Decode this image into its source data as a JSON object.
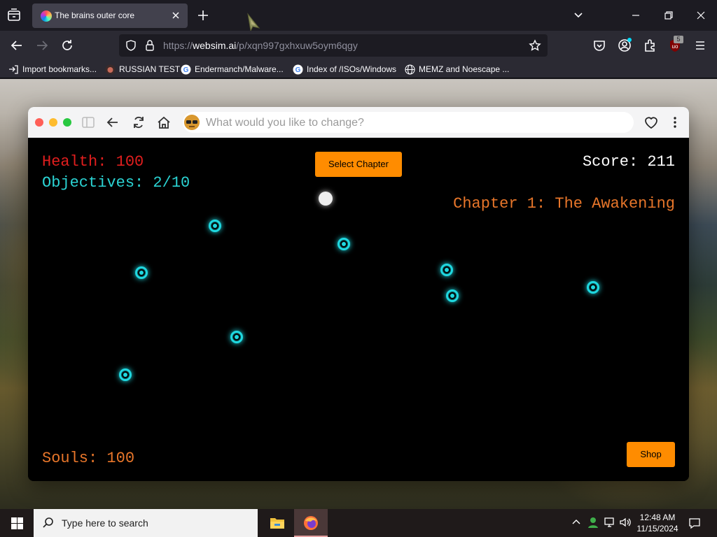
{
  "browser": {
    "tab_title": "The brains outer core",
    "url_prefix": "https://",
    "url_domain": "websim.ai",
    "url_path": "/p/xqn997gxhxuw5oym6qgy",
    "extension_badge": "5",
    "bookmarks": [
      {
        "label": "Import bookmarks...",
        "icon": "import-icon"
      },
      {
        "label": "RUSSIAN TEST",
        "icon": "octocat-icon"
      },
      {
        "label": "Endermanch/Malware...",
        "icon": "google-icon"
      },
      {
        "label": "Index of /ISOs/Windows",
        "icon": "google-icon"
      },
      {
        "label": "MEMZ and Noescape ...",
        "icon": "globe-icon"
      }
    ]
  },
  "websim": {
    "prompt_placeholder": "What would you like to change?"
  },
  "game": {
    "health": "Health: 100",
    "objectives": "Objectives: 2/10",
    "score": "Score: 211",
    "chapter": "Chapter 1: The Awakening",
    "souls": "Souls: 100",
    "select_chapter_label": "Select Chapter",
    "shop_label": "Shop",
    "colors": {
      "health": "#e01e1e",
      "objectives": "#2bd3d3",
      "chapter": "#e8762a",
      "button": "#ff8c00",
      "orb": "#1fd8e0"
    }
  },
  "taskbar": {
    "search_placeholder": "Type here to search",
    "time": "12:48 AM",
    "date": "11/15/2024"
  }
}
